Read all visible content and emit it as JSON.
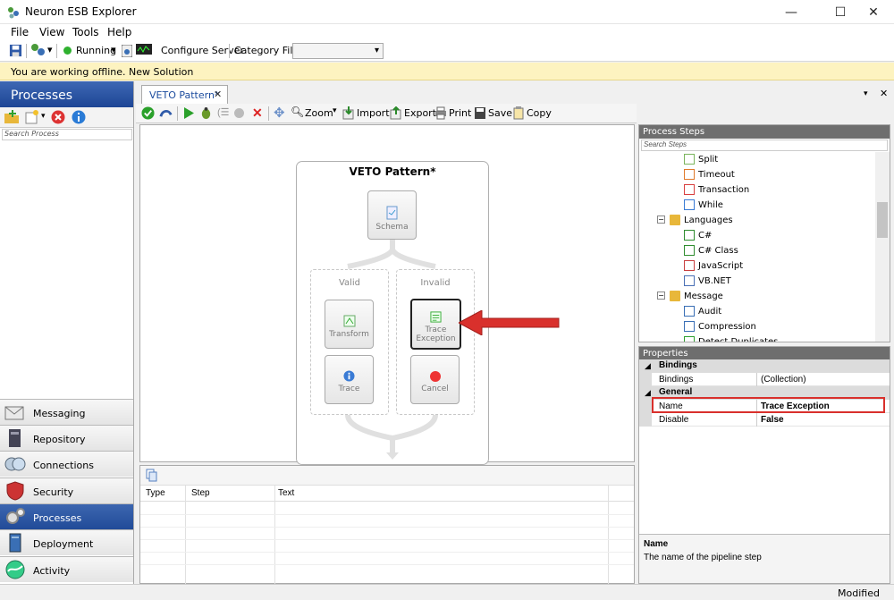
{
  "window": {
    "title": "Neuron ESB Explorer",
    "minimize": "—",
    "maximize": "☐",
    "close": "✕"
  },
  "menu": {
    "file": "File",
    "view": "View",
    "tools": "Tools",
    "help": "Help"
  },
  "toolbar": {
    "status": "Running",
    "configure_server": "Configure Server",
    "category_filter": "Category Filter",
    "category_value": ""
  },
  "banner": {
    "text": "You are working offline. New Solution"
  },
  "left": {
    "header": "Processes",
    "search_placeholder": "Search Process",
    "nav": [
      "Messaging",
      "Repository",
      "Connections",
      "Security",
      "Processes",
      "Deployment",
      "Activity"
    ]
  },
  "document": {
    "tab_label": "VETO Pattern*",
    "tools": {
      "zoom": "Zoom",
      "import": "Import",
      "export": "Export",
      "print": "Print",
      "save": "Save",
      "copy": "Copy"
    },
    "canvas": {
      "title": "VETO Pattern*",
      "schema": "Schema",
      "branch_valid": "Valid",
      "branch_invalid": "Invalid",
      "transform": "Transform",
      "trace": "Trace",
      "trace_exception_1": "Trace",
      "trace_exception_2": "Exception",
      "cancel": "Cancel"
    },
    "grid": {
      "columns": [
        "Type",
        "Step",
        "Text"
      ]
    }
  },
  "process_steps": {
    "header": "Process Steps",
    "search_placeholder": "Search Steps",
    "items": [
      {
        "label": "Split",
        "indent": 2
      },
      {
        "label": "Timeout",
        "indent": 2
      },
      {
        "label": "Transaction",
        "indent": 2
      },
      {
        "label": "While",
        "indent": 2
      },
      {
        "label": "Languages",
        "indent": 1,
        "folder": true
      },
      {
        "label": "C#",
        "indent": 2
      },
      {
        "label": "C# Class",
        "indent": 2
      },
      {
        "label": "JavaScript",
        "indent": 2
      },
      {
        "label": "VB.NET",
        "indent": 2
      },
      {
        "label": "Message",
        "indent": 1,
        "folder": true
      },
      {
        "label": "Audit",
        "indent": 2
      },
      {
        "label": "Compression",
        "indent": 2
      },
      {
        "label": "Detect Duplicates",
        "indent": 2
      }
    ]
  },
  "properties": {
    "header": "Properties",
    "cat_bindings": "Bindings",
    "bindings_name": "Bindings",
    "bindings_value": "(Collection)",
    "cat_general": "General",
    "name_label": "Name",
    "name_value": "Trace Exception",
    "disable_label": "Disable",
    "disable_value": "False",
    "desc_title": "Name",
    "desc_text": "The name of the pipeline step"
  },
  "status": {
    "text": "Modified"
  },
  "colors": {
    "accent": "#1d4595",
    "highlight_box": "#d9302c",
    "arrow": "#d9302c"
  }
}
